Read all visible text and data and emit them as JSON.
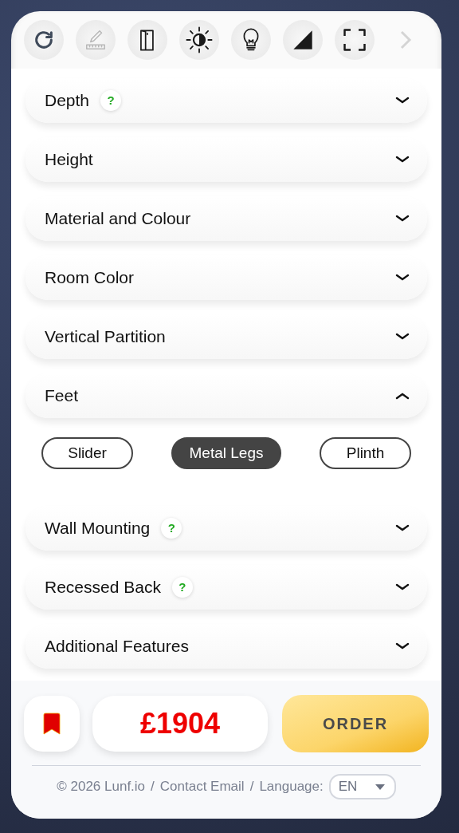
{
  "toolbar": {
    "tools": [
      {
        "kind": "rotate",
        "disabled": false
      },
      {
        "kind": "measure",
        "disabled": true
      },
      {
        "kind": "door",
        "disabled": false
      },
      {
        "kind": "contrast",
        "disabled": false
      },
      {
        "kind": "bulb",
        "disabled": false
      },
      {
        "kind": "triangle",
        "disabled": false
      },
      {
        "kind": "fullscreen",
        "disabled": false
      }
    ],
    "more_disabled": true
  },
  "sections": [
    {
      "title": "Depth",
      "help": "?",
      "expanded": false
    },
    {
      "title": "Height",
      "expanded": false
    },
    {
      "title": "Material and Colour",
      "expanded": false
    },
    {
      "title": "Room Color",
      "expanded": false
    },
    {
      "title": "Vertical Partition",
      "expanded": false
    },
    {
      "title": "Feet",
      "expanded": true,
      "options": [
        {
          "label": "Slider",
          "selected": false
        },
        {
          "label": "Metal Legs",
          "selected": true
        },
        {
          "label": "Plinth",
          "selected": false
        }
      ]
    },
    {
      "title": "Wall Mounting",
      "help": "?",
      "expanded": false
    },
    {
      "title": "Recessed Back",
      "help": "?",
      "expanded": false
    },
    {
      "title": "Additional Features",
      "expanded": false
    }
  ],
  "price": "£1904",
  "order_button": "ORDER",
  "footer": {
    "copyright": "© 2026 Lunf.io",
    "separator_1": "/",
    "contact": "Contact Email",
    "separator_2": "/",
    "language_label": "Language:",
    "language": "EN"
  }
}
